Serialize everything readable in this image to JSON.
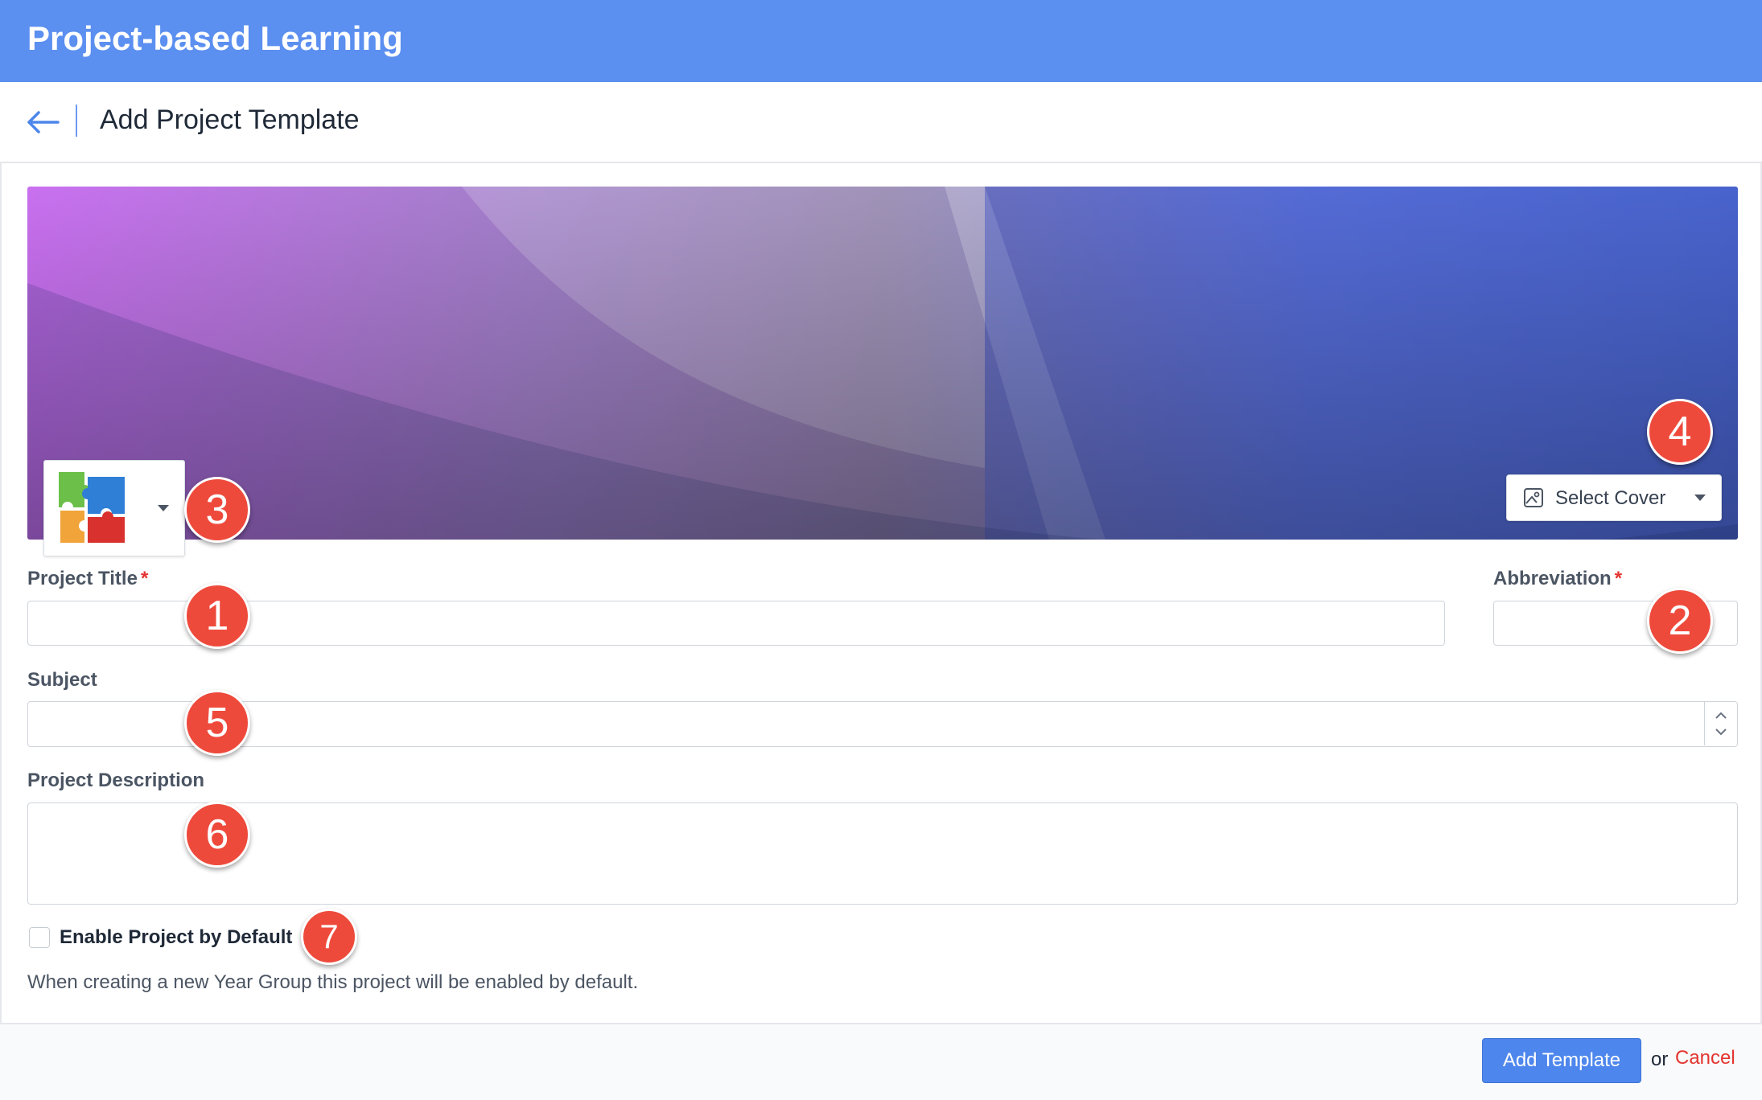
{
  "app": {
    "title": "Project-based Learning"
  },
  "subheader": {
    "title": "Add Project Template"
  },
  "cover": {
    "select_cover_label": "Select Cover",
    "colors": {
      "left": "#c86ef0",
      "right": "#4f68c8"
    }
  },
  "form": {
    "project_title": {
      "label": "Project Title",
      "required_mark": "*",
      "value": ""
    },
    "abbreviation": {
      "label": "Abbreviation",
      "required_mark": "*",
      "value": ""
    },
    "subject": {
      "label": "Subject",
      "value": ""
    },
    "description": {
      "label": "Project Description",
      "value": ""
    },
    "enable_default": {
      "label": "Enable Project by Default",
      "checked": false,
      "help": "When creating a new Year Group this project will be enabled by default."
    }
  },
  "annotations": {
    "project_title": "1",
    "abbreviation": "2",
    "icon_picker": "3",
    "select_cover": "4",
    "subject": "5",
    "description": "6",
    "enable_default": "7"
  },
  "footer": {
    "submit_label": "Add Template",
    "or_text": "or",
    "cancel_label": "Cancel"
  },
  "colors": {
    "header": "#5b8ff0",
    "primary_button": "#4d86ec",
    "cancel": "#e3342f",
    "required": "#e3342f",
    "badge": "#ee4a3c"
  },
  "icons": [
    "back-arrow-icon",
    "puzzle-icon",
    "image-icon",
    "chevron-down-icon",
    "stepper-icon"
  ]
}
